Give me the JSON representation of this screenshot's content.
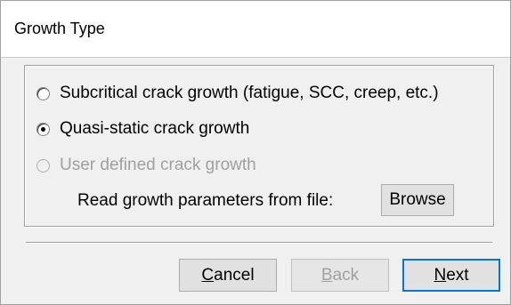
{
  "window": {
    "title": "Growth Type"
  },
  "growth_options": [
    {
      "label": "Subcritical crack growth (fatigue, SCC, creep, etc.)",
      "checked": false,
      "enabled": true
    },
    {
      "label": "Quasi-static crack growth",
      "checked": true,
      "enabled": true
    },
    {
      "label": "User defined crack growth",
      "checked": false,
      "enabled": false
    }
  ],
  "file": {
    "label": "Read growth parameters from file:",
    "browse_label": "Browse"
  },
  "footer": {
    "cancel": {
      "mnemonic": "C",
      "rest": "ancel",
      "enabled": true
    },
    "back": {
      "mnemonic": "B",
      "rest": "ack",
      "enabled": false
    },
    "next": {
      "mnemonic": "N",
      "rest": "ext",
      "enabled": true
    }
  }
}
